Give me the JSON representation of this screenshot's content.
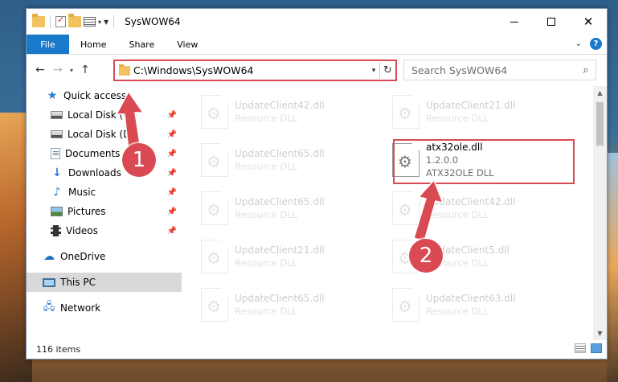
{
  "window": {
    "title": "SysWOW64",
    "controls": {
      "minimize": "minimize",
      "maximize": "maximize",
      "close": "✕"
    }
  },
  "ribbon": {
    "tabs": [
      "File",
      "Home",
      "Share",
      "View"
    ],
    "help": "?"
  },
  "address": {
    "path": "C:\\Windows\\SysWOW64",
    "search_placeholder": "Search SysWOW64"
  },
  "sidebar": {
    "items": [
      {
        "label": "Quick access",
        "icon": "star-icon",
        "pinned": false
      },
      {
        "label": "Local Disk (C:)",
        "icon": "disk-icon",
        "pinned": true
      },
      {
        "label": "Local Disk (D:)",
        "icon": "disk-icon",
        "pinned": true
      },
      {
        "label": "Documents",
        "icon": "documents-icon",
        "pinned": true
      },
      {
        "label": "Downloads",
        "icon": "download-icon",
        "pinned": true
      },
      {
        "label": "Music",
        "icon": "music-icon",
        "pinned": true
      },
      {
        "label": "Pictures",
        "icon": "pictures-icon",
        "pinned": true
      },
      {
        "label": "Videos",
        "icon": "videos-icon",
        "pinned": true
      },
      {
        "label": "OneDrive",
        "icon": "onedrive-icon",
        "pinned": false
      },
      {
        "label": "This PC",
        "icon": "this-pc-icon",
        "pinned": false,
        "selected": true
      },
      {
        "label": "Network",
        "icon": "network-icon",
        "pinned": false
      }
    ]
  },
  "files": [
    {
      "name": "UpdateClient42.dll",
      "type": "Resource DLL"
    },
    {
      "name": "UpdateClient21.dll",
      "type": "Resource DLL"
    },
    {
      "name": "UpdateClient65.dll",
      "type": "Resource DLL"
    },
    {
      "name": "atx32ole.dll",
      "version": "1.2.0.0",
      "type": "ATX32OLE DLL",
      "focused": true
    },
    {
      "name": "UpdateClient65.dll",
      "type": "Resource DLL"
    },
    {
      "name": "UpdateClient42.dll",
      "type": "Resource DLL"
    },
    {
      "name": "UpdateClient21.dll",
      "type": "Resource DLL"
    },
    {
      "name": "UpdateClient5.dll",
      "type": "Resource DLL"
    },
    {
      "name": "UpdateClient65.dll",
      "type": "Resource DLL"
    },
    {
      "name": "UpdateClient63.dll",
      "type": "Resource DLL"
    }
  ],
  "status": {
    "item_count": "116 items"
  },
  "annotations": {
    "step1": "1",
    "step2": "2",
    "color": "#d94a52"
  }
}
